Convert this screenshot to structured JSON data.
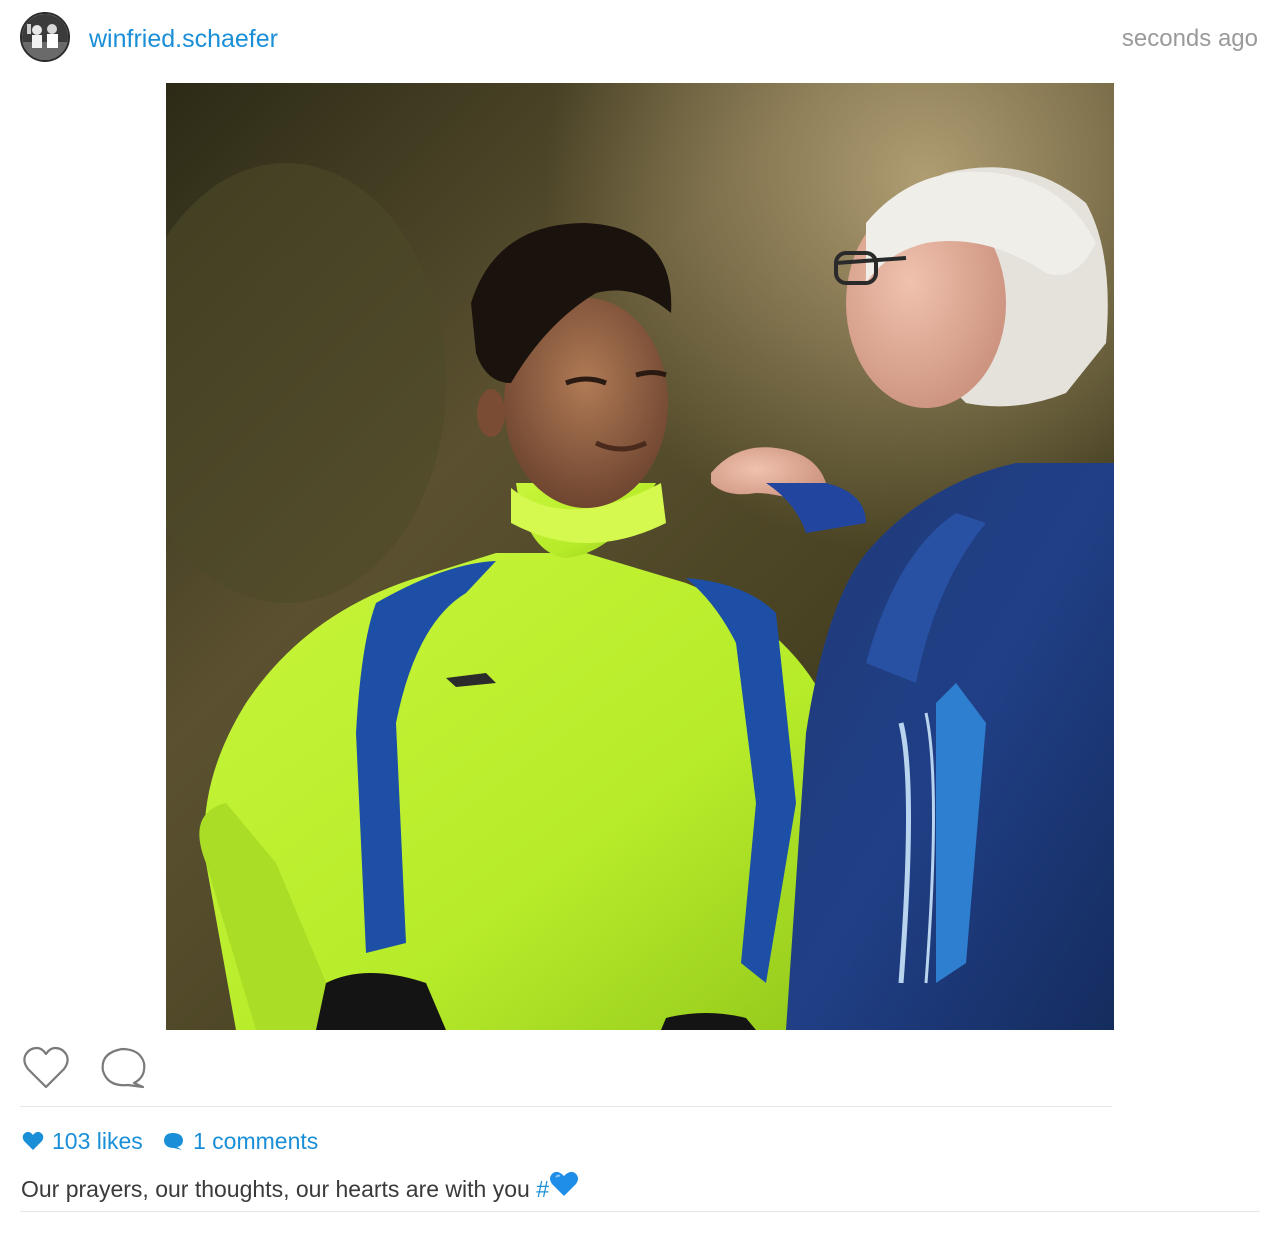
{
  "header": {
    "username": "winfried.schaefer",
    "timestamp": "seconds ago"
  },
  "actions": {
    "like_icon": "heart-outline-icon",
    "comment_icon": "comment-bubble-icon"
  },
  "stats": {
    "likes_label": "103 likes",
    "comments_label": "1 comments",
    "likes_icon": "heart-filled-icon",
    "comments_icon": "comment-filled-icon"
  },
  "caption": {
    "text": "Our prayers, our thoughts, our hearts are with you ",
    "hashtag": "#"
  },
  "colors": {
    "accent": "#1a8fd8",
    "muted_text": "#9a9a9a",
    "body_text": "#3a3a3a",
    "divider": "#e6e6e6"
  }
}
